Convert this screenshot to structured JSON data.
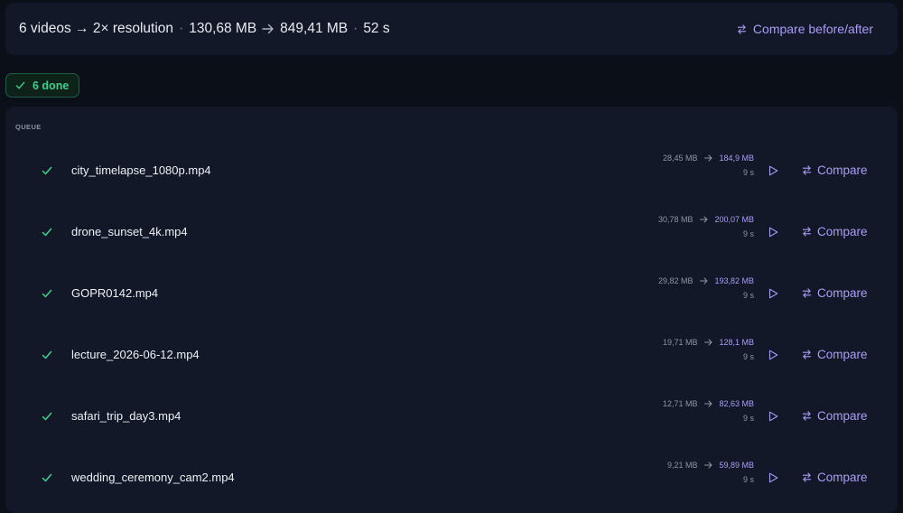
{
  "summary": {
    "videos": "6 videos → 2× resolution",
    "size_before": "130,68 MB",
    "size_after": "849,41 MB",
    "duration": "52 s",
    "compare_label": "Compare before/after"
  },
  "badge": {
    "label": "6 done"
  },
  "queue": {
    "label": "QUEUE",
    "compare_label": "Compare",
    "items": [
      {
        "name": "city_timelapse_1080p.mp4",
        "before": "28,45 MB",
        "after": "184,9 MB",
        "time": "9 s"
      },
      {
        "name": "drone_sunset_4k.mp4",
        "before": "30,78 MB",
        "after": "200,07 MB",
        "time": "9 s"
      },
      {
        "name": "GOPR0142.mp4",
        "before": "29,82 MB",
        "after": "193,82 MB",
        "time": "9 s"
      },
      {
        "name": "lecture_2026-06-12.mp4",
        "before": "19,71 MB",
        "after": "128,1 MB",
        "time": "9 s"
      },
      {
        "name": "safari_trip_day3.mp4",
        "before": "12,71 MB",
        "after": "82,63 MB",
        "time": "9 s"
      },
      {
        "name": "wedding_ceremony_cam2.mp4",
        "before": "9,21 MB",
        "after": "59,89 MB",
        "time": "9 s"
      }
    ]
  },
  "colors": {
    "accent": "#a99cf5",
    "success": "#3ecf8e",
    "panel": "#121827",
    "background": "#0b0f17"
  }
}
